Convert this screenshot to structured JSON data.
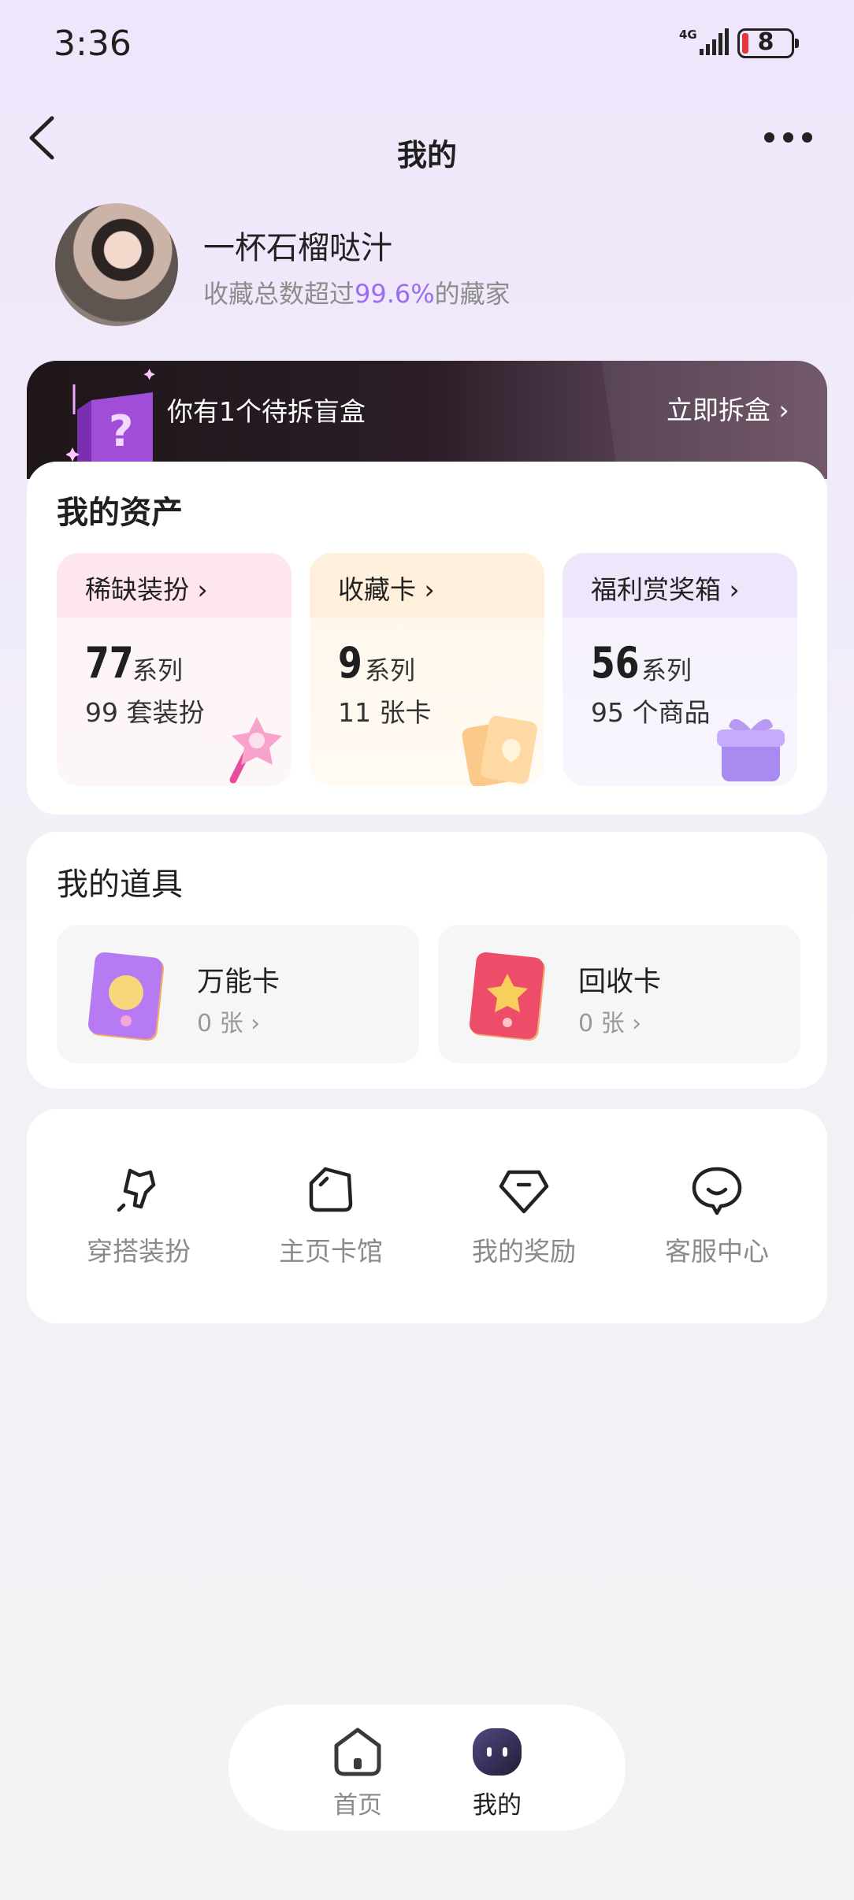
{
  "status_bar": {
    "time": "3:36",
    "network": "4G",
    "battery": "8"
  },
  "header": {
    "title": "我的"
  },
  "profile": {
    "username": "一杯石榴哒汁",
    "collector_prefix": "收藏总数超过",
    "collector_percent": "99.6%",
    "collector_suffix": "的藏家"
  },
  "blind_box": {
    "text": "你有1个待拆盲盒",
    "action": "立即拆盒 ›"
  },
  "assets": {
    "title": "我的资产",
    "items": [
      {
        "label": "稀缺装扮 ›",
        "count": "77",
        "unit": "系列",
        "sub": "99 套装扮",
        "color": "#fde6ee"
      },
      {
        "label": "收藏卡 ›",
        "count": "9",
        "unit": "系列",
        "sub": "11 张卡",
        "color": "#fff0dd"
      },
      {
        "label": "福利赏奖箱 ›",
        "count": "56",
        "unit": "系列",
        "sub": "95 个商品",
        "color": "#efe6fc"
      }
    ]
  },
  "tools": {
    "title": "我的道具",
    "items": [
      {
        "name": "万能卡",
        "count": "0 张 ›"
      },
      {
        "name": "回收卡",
        "count": "0 张 ›"
      }
    ]
  },
  "menu": {
    "items": [
      {
        "label": "穿搭装扮",
        "icon": "outfit-icon"
      },
      {
        "label": "主页卡馆",
        "icon": "card-hall-icon"
      },
      {
        "label": "我的奖励",
        "icon": "reward-icon"
      },
      {
        "label": "客服中心",
        "icon": "service-icon"
      }
    ]
  },
  "bottom_nav": {
    "items": [
      {
        "label": "首页",
        "icon": "home-icon"
      },
      {
        "label": "我的",
        "icon": "mine-icon",
        "active": true
      }
    ]
  }
}
